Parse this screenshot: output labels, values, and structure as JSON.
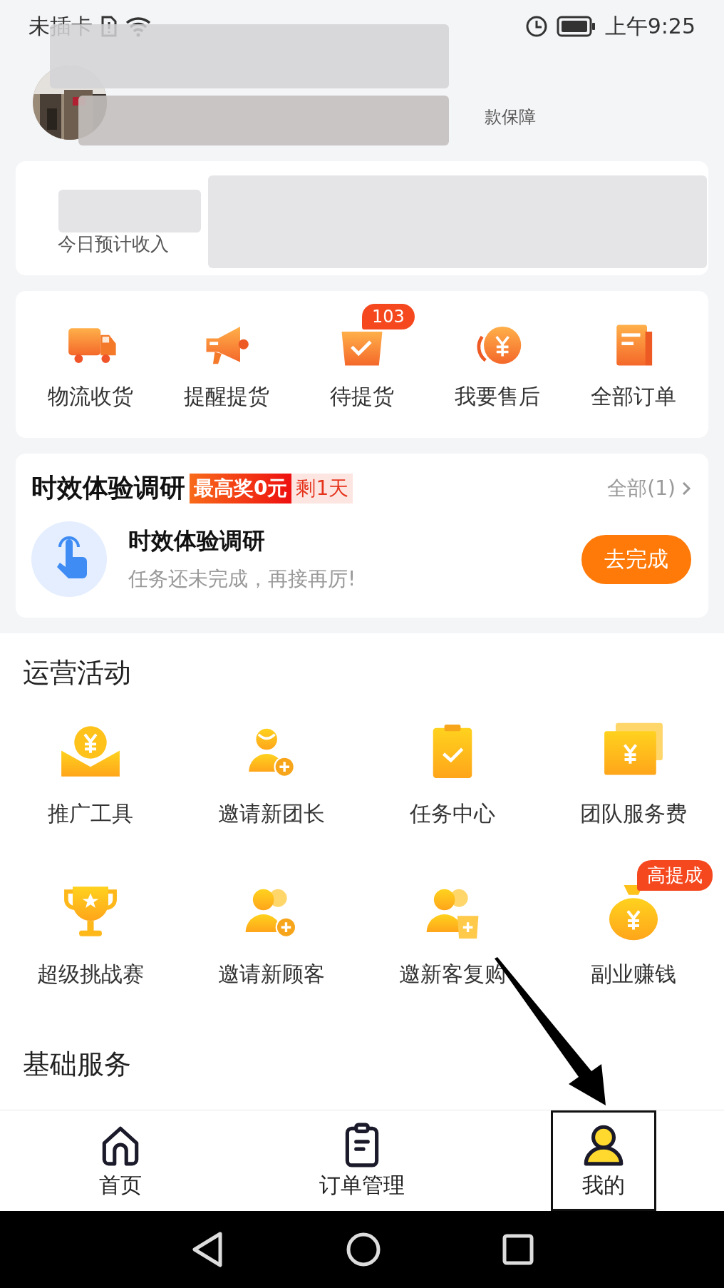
{
  "status_bar": {
    "carrier": "未插卡",
    "time": "上午9:25"
  },
  "profile": {
    "tag": "款保障"
  },
  "stats": {
    "items": [
      {
        "label": "今日预计收入"
      }
    ]
  },
  "shortcuts": [
    {
      "label": "物流收货"
    },
    {
      "label": "提醒提货"
    },
    {
      "label": "待提货",
      "badge": "103"
    },
    {
      "label": "我要售后"
    },
    {
      "label": "全部订单"
    }
  ],
  "survey": {
    "title": "时效体验调研",
    "reward": "最高奖0元",
    "remaining": "剩1天",
    "all_link": "全部(1)",
    "task_title": "时效体验调研",
    "task_subtitle": "任务还未完成，再接再厉!",
    "button": "去完成"
  },
  "activities": {
    "title": "运营活动",
    "items": [
      {
        "label": "推广工具"
      },
      {
        "label": "邀请新团长"
      },
      {
        "label": "任务中心"
      },
      {
        "label": "团队服务费"
      },
      {
        "label": "超级挑战赛"
      },
      {
        "label": "邀请新顾客"
      },
      {
        "label": "邀新客复购"
      },
      {
        "label": "副业赚钱",
        "badge": "高提成"
      }
    ]
  },
  "basic_services": {
    "title": "基础服务"
  },
  "tab_bar": [
    {
      "label": "首页",
      "selected": false,
      "highlighted": false
    },
    {
      "label": "订单管理",
      "selected": false,
      "highlighted": false
    },
    {
      "label": "我的",
      "selected": true,
      "highlighted": true
    }
  ]
}
